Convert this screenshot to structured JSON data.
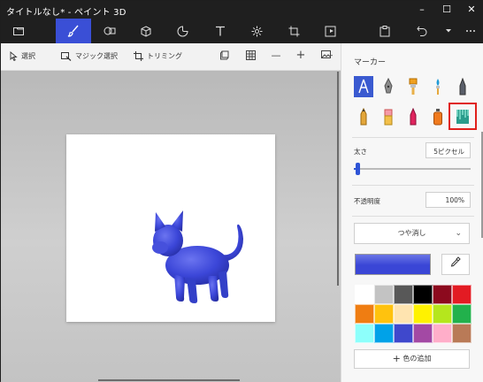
{
  "window": {
    "title": "タイトルなし* - ペイント 3D",
    "minimize": "–",
    "maximize": "☐",
    "close": "✕"
  },
  "toolbar": {
    "items": [
      {
        "name": "menu",
        "icon": "folder-icon"
      },
      {
        "name": "brushes",
        "icon": "brush-icon"
      },
      {
        "name": "2d-shapes",
        "icon": "2d-shapes-icon"
      },
      {
        "name": "3d-shapes",
        "icon": "3d-shapes-icon"
      },
      {
        "name": "stickers",
        "icon": "sticker-icon"
      },
      {
        "name": "text",
        "icon": "text-icon"
      },
      {
        "name": "effects",
        "icon": "effects-icon"
      },
      {
        "name": "canvas",
        "icon": "canvas-icon"
      },
      {
        "name": "3d-library",
        "icon": "3d-library-icon"
      },
      {
        "name": "paste",
        "icon": "paste-icon"
      },
      {
        "name": "undo",
        "icon": "undo-icon"
      },
      {
        "name": "history",
        "icon": "chevron-down-icon"
      },
      {
        "name": "more",
        "icon": "more-icon"
      }
    ],
    "active": "brushes",
    "accent": "#3a4fd6"
  },
  "subbar": {
    "select": "選択",
    "magic_select": "マジック選択",
    "crop": "トリミング",
    "zoom_level_sign_minus": "—",
    "zoom_level_sign_plus": "+"
  },
  "panel": {
    "title": "マーカー",
    "brushes_row1": [
      "marker-icon",
      "calligraphy-pen-icon",
      "oil-brush-icon",
      "watercolor-icon",
      "pixel-pen-icon"
    ],
    "brushes_row2": [
      "pencil-icon",
      "eraser-icon",
      "crayon-icon",
      "spray-can-icon",
      "fill-icon"
    ],
    "selected_brush": "marker-icon",
    "highlighted_brush": "fill-icon",
    "thickness_label": "太さ",
    "thickness_value": "5ピクセル",
    "thickness_level": 0.04,
    "opacity_label": "不透明度",
    "opacity_value": "100%",
    "finish": "つや消し",
    "current_color": "#3a46d6",
    "palette": [
      "#ffffff",
      "#c3c3c3",
      "#585858",
      "#000000",
      "#8c0a1e",
      "#e31b23",
      "#ef7d12",
      "#ffc20e",
      "#ffe4b0",
      "#fff200",
      "#b5e61d",
      "#22b14c",
      "#8dfffb",
      "#00a2e8",
      "#3f48cc",
      "#a349a4",
      "#ffaec9",
      "#b97a57"
    ],
    "add_color": "色の追加"
  }
}
